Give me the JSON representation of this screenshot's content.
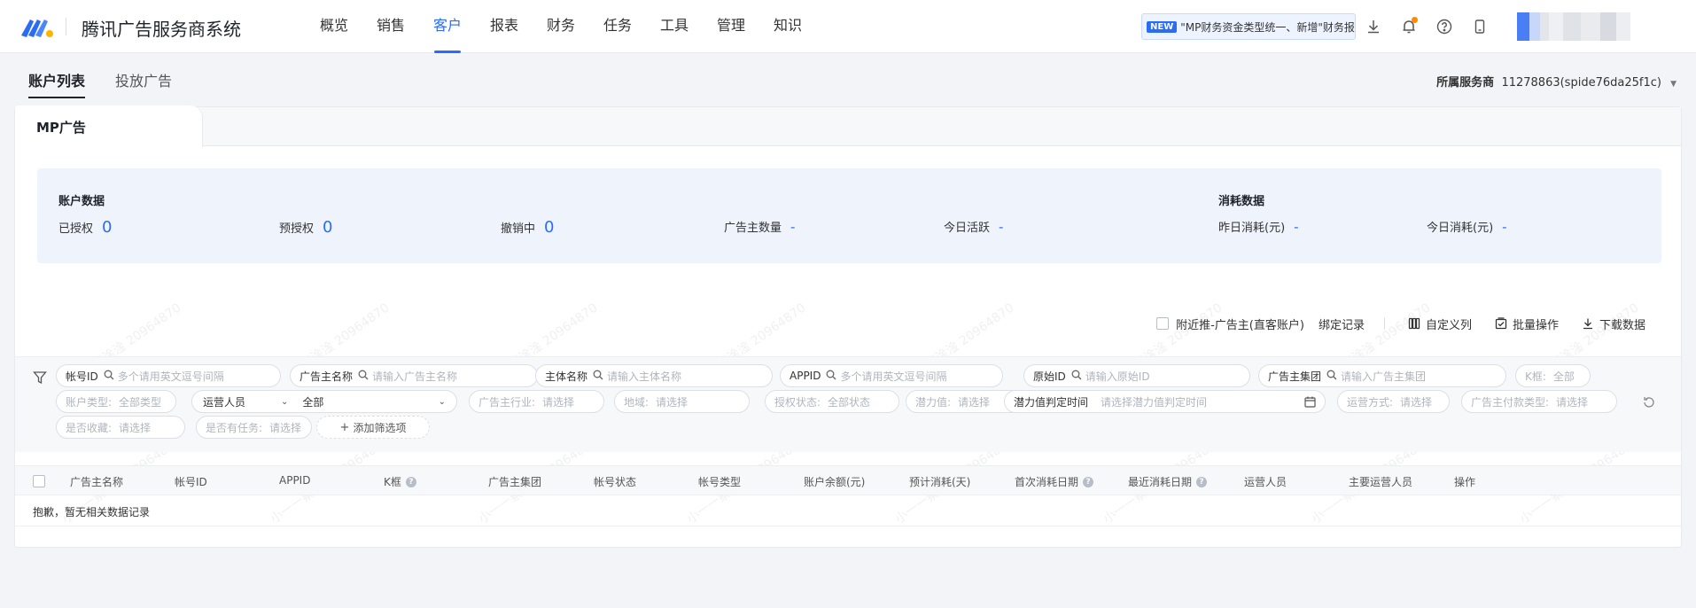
{
  "app": {
    "title": "腾讯广告服务商系统"
  },
  "nav": [
    "概览",
    "销售",
    "客户",
    "报表",
    "财务",
    "任务",
    "工具",
    "管理",
    "知识"
  ],
  "nav_active": "客户",
  "notice": {
    "badge": "NEW",
    "text": "\"MP财务资金类型统一、新增\"财务报"
  },
  "top_icons": [
    "download-icon",
    "bell-icon",
    "help-icon",
    "mobile-icon"
  ],
  "subtabs": [
    "账户列表",
    "投放广告"
  ],
  "vendor": {
    "label": "所属服务商",
    "value": "11278863(spide76da25f1c)"
  },
  "card_tab": "MP广告",
  "account_stats": {
    "title": "账户数据",
    "items": [
      {
        "label": "已授权",
        "value": "0"
      },
      {
        "label": "预授权",
        "value": "0"
      },
      {
        "label": "撤销中",
        "value": "0"
      },
      {
        "label": "广告主数量",
        "value": "-"
      },
      {
        "label": "今日活跃",
        "value": "-"
      }
    ]
  },
  "spend_stats": {
    "title": "消耗数据",
    "items": [
      {
        "label": "昨日消耗(元)",
        "value": "-"
      },
      {
        "label": "今日消耗(元)",
        "value": "-"
      }
    ]
  },
  "actions": {
    "nearby_label": "附近推-广告主(直客账户)",
    "bind_record": "绑定记录",
    "custom_columns": "自定义列",
    "batch": "批量操作",
    "download": "下载数据"
  },
  "filters": {
    "row1": [
      {
        "label": "帐号ID",
        "placeholder": "多个请用英文逗号间隔"
      },
      {
        "label": "广告主名称",
        "placeholder": "请输入广告主名称"
      },
      {
        "label": "主体名称",
        "placeholder": "请输入主体名称"
      },
      {
        "label": "APPID",
        "placeholder": "多个请用英文逗号间隔"
      },
      {
        "label": "原始ID",
        "placeholder": "请输入原始ID"
      },
      {
        "label": "广告主集团",
        "placeholder": "请输入广告主集团"
      },
      {
        "label": "K框:",
        "placeholder": "全部"
      }
    ],
    "account_type": {
      "label": "账户类型:",
      "value": "全部类型"
    },
    "operator": {
      "label": "运营人员",
      "value": "全部"
    },
    "row2": [
      {
        "label": "广告主行业:",
        "value": "请选择"
      },
      {
        "label": "地域:",
        "value": "请选择"
      },
      {
        "label": "授权状态:",
        "value": "全部状态"
      },
      {
        "label": "潜力值:",
        "value": "请选择"
      }
    ],
    "potential_date": {
      "label": "潜力值判定时间",
      "placeholder": "请选择潜力值判定时间"
    },
    "row2b": [
      {
        "label": "运营方式:",
        "value": "请选择"
      },
      {
        "label": "广告主付款类型:",
        "value": "请选择"
      }
    ],
    "row3": [
      {
        "label": "是否收藏:",
        "value": "请选择"
      },
      {
        "label": "是否有任务:",
        "value": "请选择"
      }
    ],
    "add_filter": "添加筛选项"
  },
  "table": {
    "columns": [
      "广告主名称",
      "帐号ID",
      "APPID",
      "K框",
      "广告主集团",
      "帐号状态",
      "帐号类型",
      "账户余额(元)",
      "预计消耗(天)",
      "首次消耗日期",
      "最近消耗日期",
      "运营人员",
      "主要运营人员",
      "操作"
    ],
    "columns_with_help": [
      "K框",
      "首次消耗日期",
      "最近消耗日期"
    ],
    "empty_text": "抱歉，暂无相关数据记录"
  },
  "watermark": "小一一蔡淦淦 20964870",
  "colors": {
    "accent": "#2a6df4",
    "panel": "#eef3fc",
    "notice_dot": "#ff8a00"
  }
}
